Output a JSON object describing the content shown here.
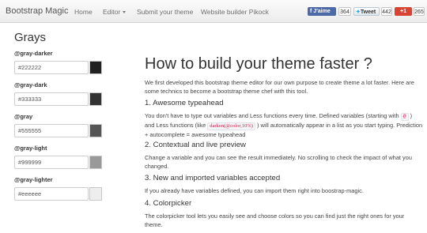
{
  "navbar": {
    "brand": "Bootstrap Magic",
    "items": [
      {
        "label": "Home"
      },
      {
        "label": "Editor"
      },
      {
        "label": "Submit your theme"
      },
      {
        "label": "Website builder Pikock"
      }
    ],
    "social": {
      "facebook_label": "J'aime",
      "facebook_count": "364",
      "twitter_label": "Tweet",
      "twitter_count": "442",
      "gplus_label": "+1",
      "gplus_count": "265"
    }
  },
  "sidebar": {
    "title": "Grays",
    "variables": [
      {
        "name": "@gray-darker",
        "value": "#222222",
        "color": "#222222"
      },
      {
        "name": "@gray-dark",
        "value": "#333333",
        "color": "#333333"
      },
      {
        "name": "@gray",
        "value": "#555555",
        "color": "#555555"
      },
      {
        "name": "@gray-light",
        "value": "#999999",
        "color": "#999999"
      },
      {
        "name": "@gray-lighter",
        "value": "#eeeeee",
        "color": "#eeeeee"
      }
    ]
  },
  "main": {
    "title": "How to build your theme faster ?",
    "intro": "We first developed this bootstrap theme editor for our own purpose to create theme a lot faster. Here are some technics to become a bootstrap theme chef with this tool.",
    "sections": [
      {
        "heading": "1. Awesome typeahead",
        "text_a": "You don't have to type out variables and Less functions every time. Defined variables (starting with",
        "code_at": "@",
        "text_b": ") and Less functions (like",
        "code_fn": "darken(@color,10%)",
        "text_c": ") will automatically appear in a list as you start typing. Prediction + autocomplete = awesome typeahead"
      },
      {
        "heading": "2. Contextual and live preview",
        "text": "Change a variable and you can see the result immediately. No scrolling to check the impact of what you changed."
      },
      {
        "heading": "3. New and imported variables accepted",
        "text": "If you already have variables defined, you can import them right into boostrap-magic."
      },
      {
        "heading": "4. Colorpicker",
        "text": "The colorpicker tool lets you easily see and choose colors so you can find just the right ones for your theme."
      }
    ]
  }
}
